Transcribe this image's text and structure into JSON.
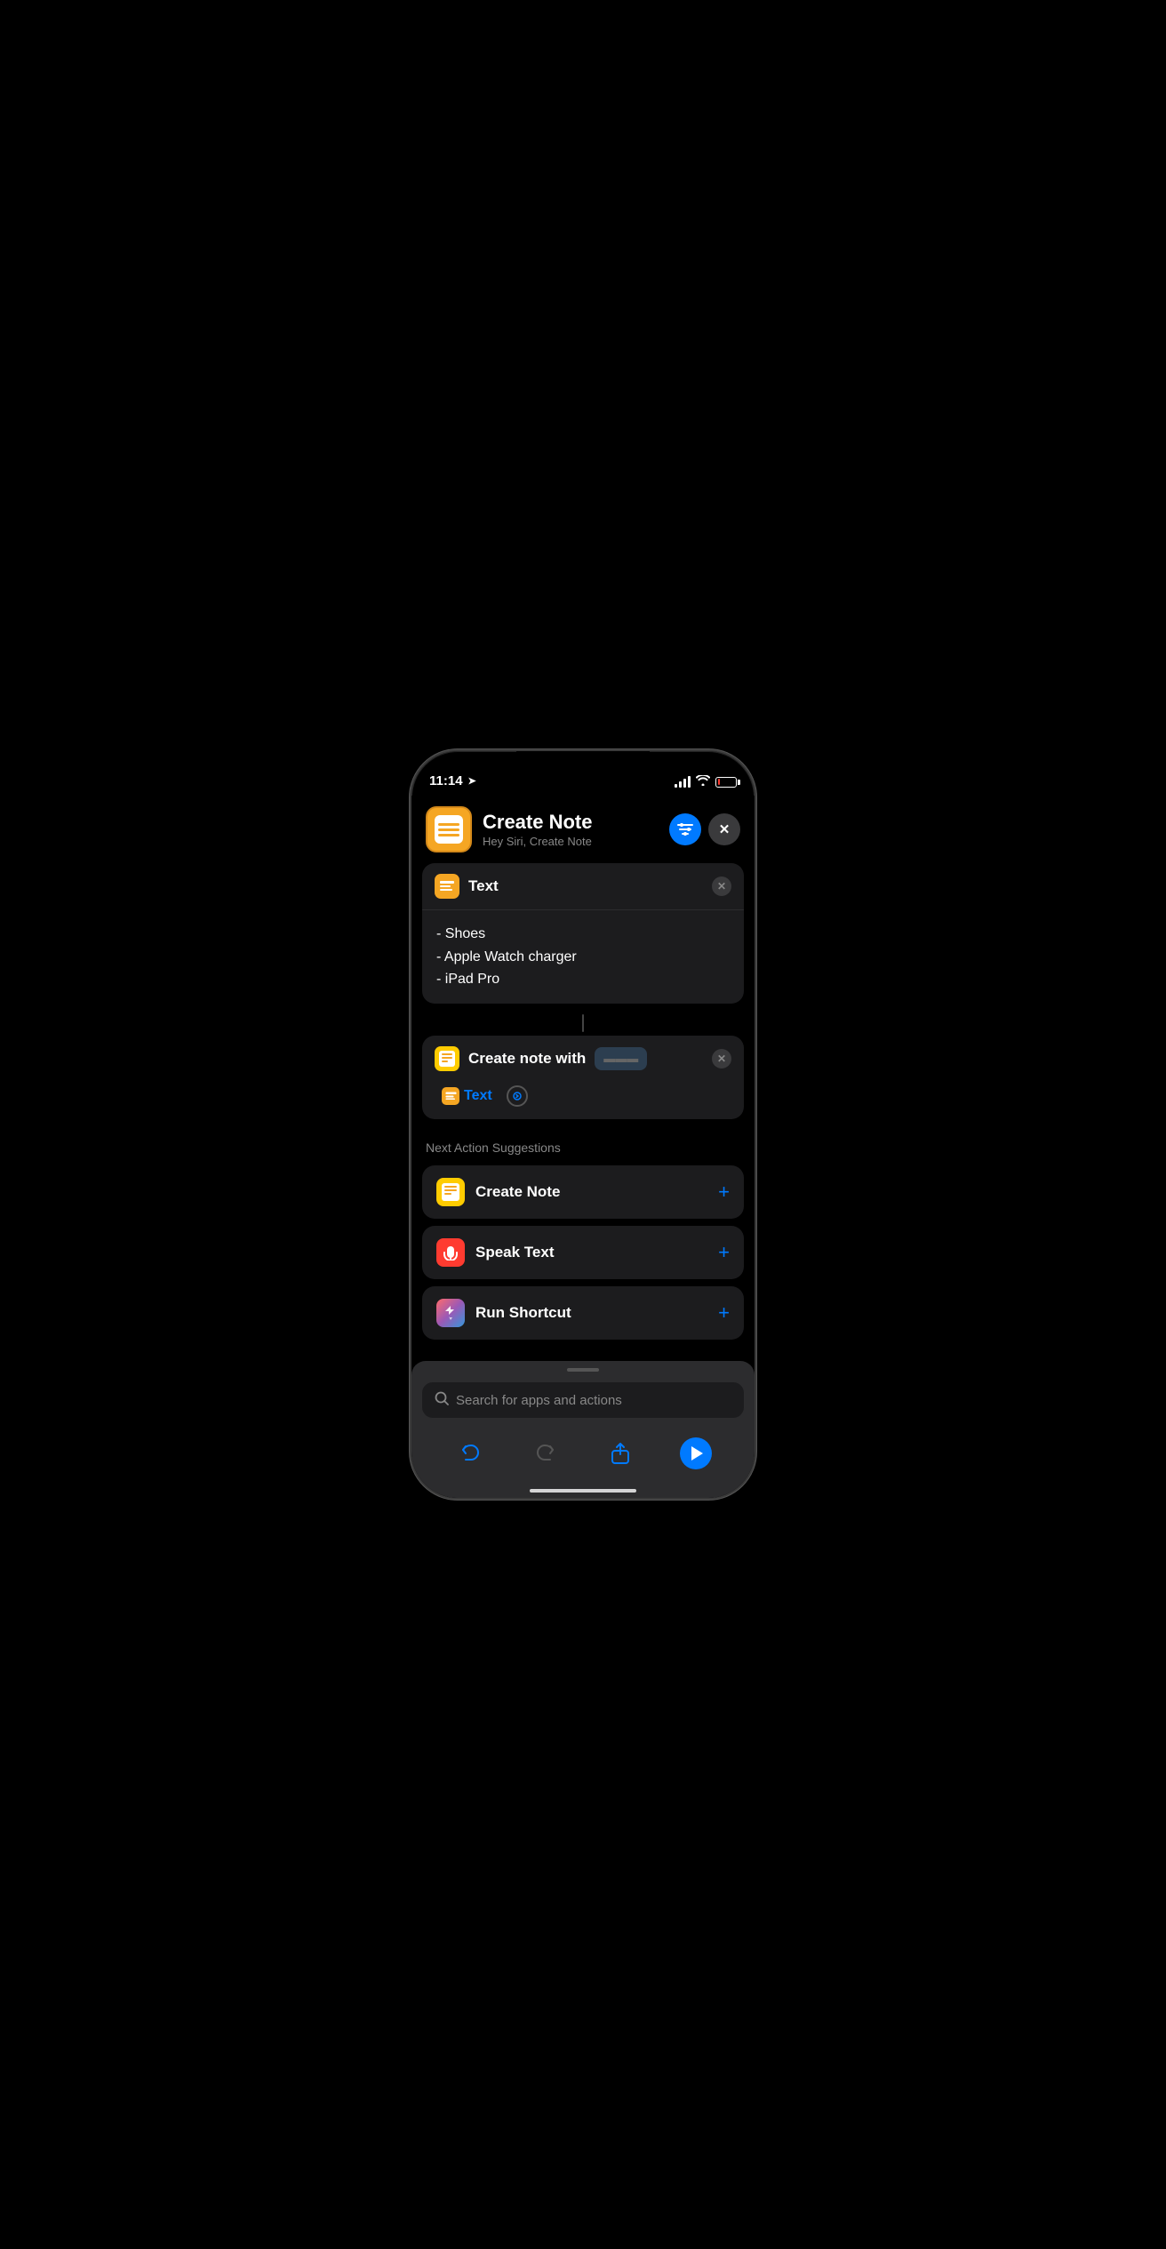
{
  "statusBar": {
    "time": "11:14",
    "locationArrow": "➤"
  },
  "header": {
    "title": "Create Note",
    "subtitle": "Hey Siri, Create Note",
    "filterBtnLabel": "Filter",
    "closeBtnLabel": "✕"
  },
  "textCard": {
    "iconLabel": "Text icon",
    "title": "Text",
    "closeLabel": "✕",
    "bodyLines": [
      "- Shoes",
      "- Apple Watch charger",
      "- iPad Pro"
    ]
  },
  "createNoteCard": {
    "iconLabel": "Note icon",
    "actionLabel": "Create note with",
    "closeLabel": "✕",
    "variableLabel": "Text",
    "chevronLabel": "›"
  },
  "suggestions": {
    "sectionTitle": "Next Action Suggestions",
    "items": [
      {
        "name": "Create Note",
        "iconType": "yellow",
        "addLabel": "+"
      },
      {
        "name": "Speak Text",
        "iconType": "red",
        "addLabel": "+"
      },
      {
        "name": "Run Shortcut",
        "iconType": "gradient",
        "addLabel": "+"
      }
    ]
  },
  "bottomSheet": {
    "searchPlaceholder": "Search for apps and actions",
    "undoLabel": "Undo",
    "redoLabel": "Redo",
    "shareLabel": "Share",
    "playLabel": "Play"
  }
}
